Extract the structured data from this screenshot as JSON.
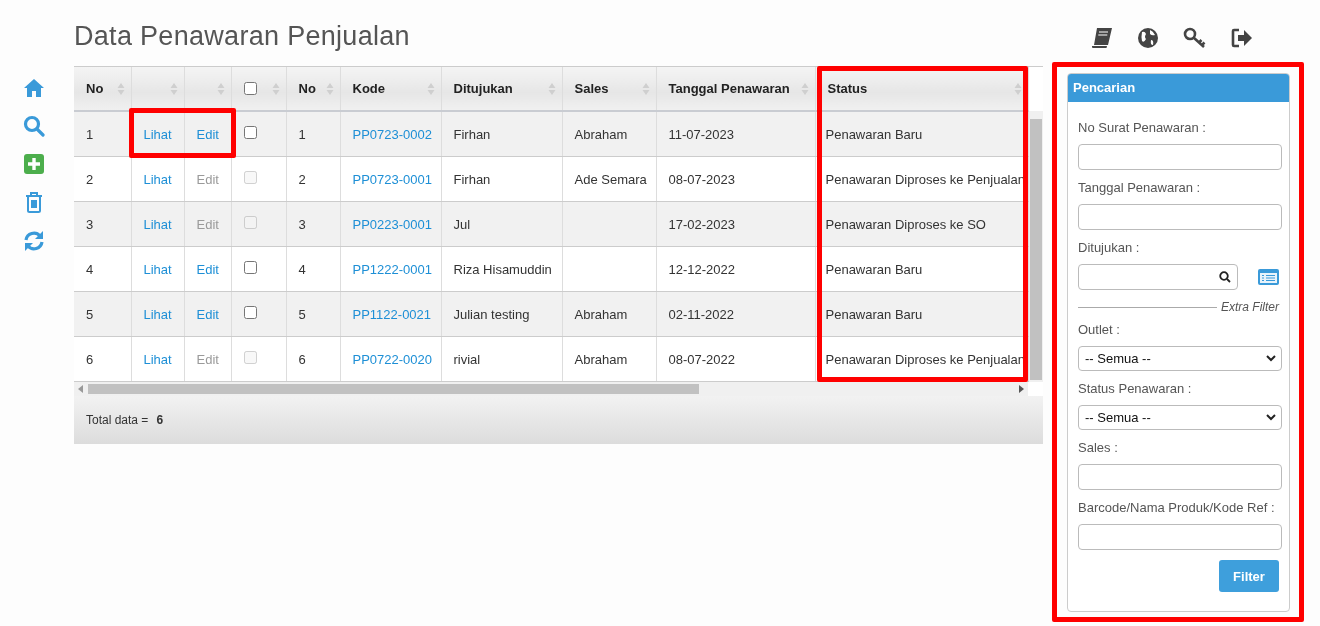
{
  "title": "Data Penawaran Penjualan",
  "table": {
    "columns": [
      {
        "kind": "text",
        "label": "No"
      },
      {
        "kind": "blank"
      },
      {
        "kind": "blank"
      },
      {
        "kind": "checkbox",
        "checked": false
      },
      {
        "kind": "text",
        "label": "No"
      },
      {
        "kind": "text",
        "label": "Kode"
      },
      {
        "kind": "text",
        "label": "Ditujukan"
      },
      {
        "kind": "text",
        "label": "Sales"
      },
      {
        "kind": "text",
        "label": "Tanggal Penawaran"
      },
      {
        "kind": "text",
        "label": "Status"
      }
    ],
    "rows": [
      {
        "no": "1",
        "view": "Lihat",
        "edit": "Edit",
        "editable": true,
        "checked": false,
        "no2": "1",
        "kode": "PP0723-0002",
        "ditujukan": "Firhan",
        "sales": "Abraham",
        "tanggal": "11-07-2023",
        "status": "Penawaran Baru"
      },
      {
        "no": "2",
        "view": "Lihat",
        "edit": "Edit",
        "editable": false,
        "checked": false,
        "no2": "2",
        "kode": "PP0723-0001",
        "ditujukan": "Firhan",
        "sales": "Ade Semara",
        "tanggal": "08-07-2023",
        "status": "Penawaran Diproses ke Penjualan"
      },
      {
        "no": "3",
        "view": "Lihat",
        "edit": "Edit",
        "editable": false,
        "checked": false,
        "no2": "3",
        "kode": "PP0223-0001",
        "ditujukan": "Jul",
        "tanggal": "17-02-2023",
        "status": "Penawaran Diproses ke SO"
      },
      {
        "no": "4",
        "view": "Lihat",
        "edit": "Edit",
        "editable": true,
        "checked": false,
        "no2": "4",
        "kode": "PP1222-0001",
        "ditujukan": "Riza Hisamuddin",
        "tanggal": "12-12-2022",
        "status": "Penawaran Baru"
      },
      {
        "no": "5",
        "view": "Lihat",
        "edit": "Edit",
        "editable": true,
        "checked": false,
        "no2": "5",
        "kode": "PP1122-0021",
        "ditujukan": "Julian testing",
        "sales": "Abraham",
        "tanggal": "02-11-2022",
        "status": "Penawaran Baru"
      },
      {
        "no": "6",
        "view": "Lihat",
        "edit": "Edit",
        "editable": false,
        "checked": false,
        "no2": "6",
        "kode": "PP0722-0020",
        "ditujukan": "rivial",
        "sales": "Abraham",
        "tanggal": "08-07-2022",
        "status": "Penawaran Diproses ke Penjualan"
      }
    ],
    "footer": {
      "label": "Total data =",
      "value": "6"
    }
  },
  "search_panel": {
    "title": "Pencarian",
    "fields": [
      {
        "kind": "text",
        "label": "No Surat Penawaran :"
      },
      {
        "kind": "text",
        "label": "Tanggal Penawaran :"
      },
      {
        "kind": "lookup",
        "label": "Ditujukan :"
      },
      {
        "kind": "divider",
        "label": "Extra Filter"
      },
      {
        "kind": "select",
        "label": "Outlet :",
        "value": "-- Semua --"
      },
      {
        "kind": "select",
        "label": "Status Penawaran :",
        "value": "-- Semua --"
      },
      {
        "kind": "text",
        "label": "Sales :"
      },
      {
        "kind": "text",
        "label": "Barcode/Nama Produk/Kode Ref :"
      }
    ],
    "button": "Filter"
  }
}
